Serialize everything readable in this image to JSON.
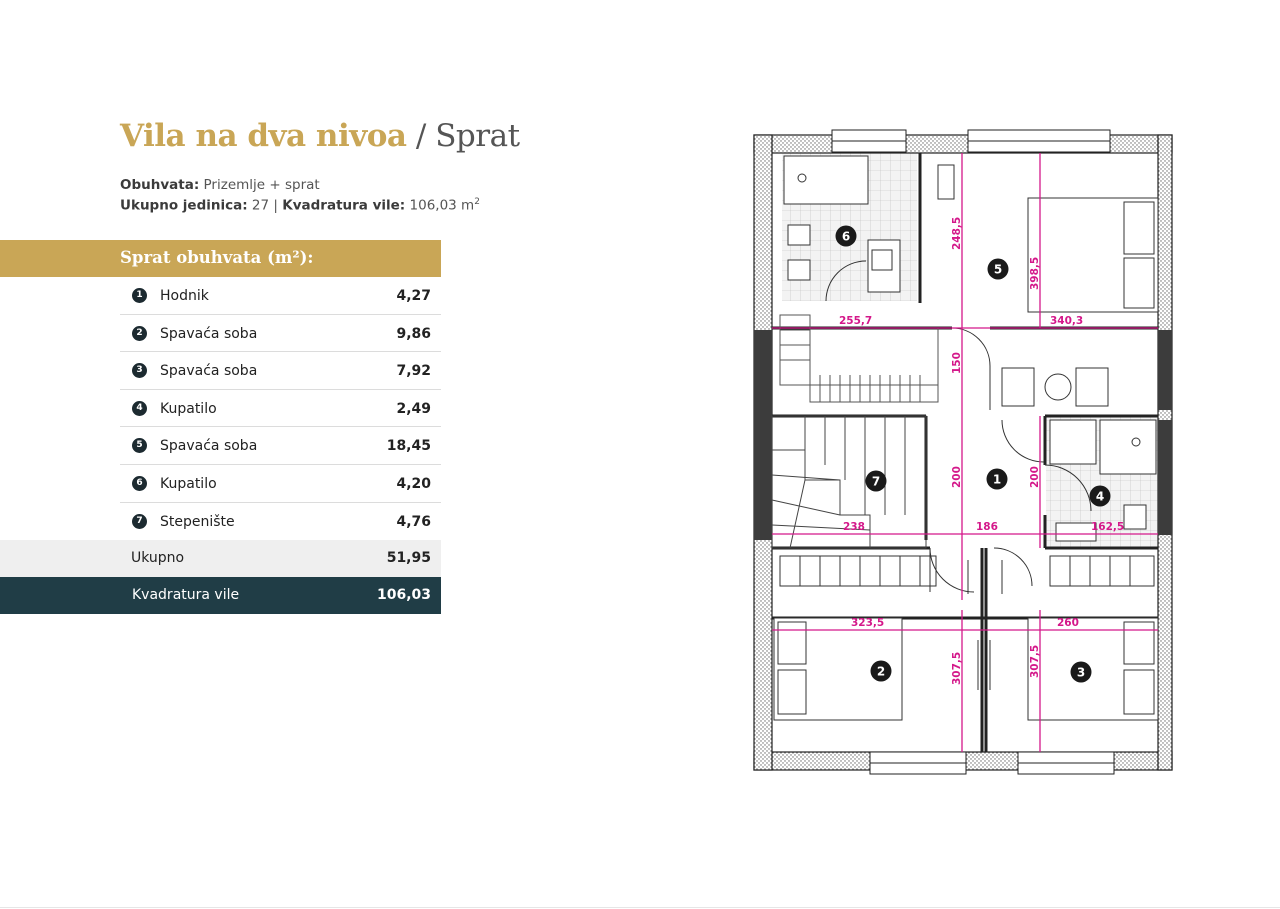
{
  "title": {
    "main": "Vila na dva nivoa",
    "sep": "/",
    "sub": "Sprat"
  },
  "meta": {
    "obuhvata_label": "Obuhvata:",
    "obuhvata_value": "Prizemlje + sprat",
    "jedinica_label": "Ukupno jedinica:",
    "jedinica_value": "27",
    "divider": "|",
    "kvadratura_label": "Kvadratura vile:",
    "kvadratura_value": "106,03 m",
    "kvadratura_sup": "2"
  },
  "table": {
    "header": "Sprat obuhvata (m²):",
    "rows": [
      {
        "num": "1",
        "name": "Hodnik",
        "value": "4,27"
      },
      {
        "num": "2",
        "name": "Spavaća soba",
        "value": "9,86"
      },
      {
        "num": "3",
        "name": "Spavaća soba",
        "value": "7,92"
      },
      {
        "num": "4",
        "name": "Kupatilo",
        "value": "2,49"
      },
      {
        "num": "5",
        "name": "Spavaća soba",
        "value": "18,45"
      },
      {
        "num": "6",
        "name": "Kupatilo",
        "value": "4,20"
      },
      {
        "num": "7",
        "name": "Stepenište",
        "value": "4,76"
      }
    ],
    "total_label": "Ukupno",
    "total_value": "51,95",
    "kvadratura_label": "Kvadratura vile",
    "kvadratura_value": "106,03"
  },
  "plan": {
    "markers": [
      "1",
      "2",
      "3",
      "4",
      "5",
      "6",
      "7"
    ],
    "dimensions": {
      "d_248_5": "248,5",
      "d_398_5": "398,5",
      "d_255_7": "255,7",
      "d_340_3": "340,3",
      "d_150": "150",
      "d_200_a": "200",
      "d_200_b": "200",
      "d_238": "238",
      "d_186": "186",
      "d_162_5": "162,5",
      "d_323_5": "323,5",
      "d_260": "260",
      "d_307_5_a": "307,5",
      "d_307_5_b": "307,5"
    }
  },
  "colors": {
    "gold": "#c9a656",
    "dark": "#203d46",
    "dimension": "#d4188a",
    "light_row": "#efefef"
  }
}
